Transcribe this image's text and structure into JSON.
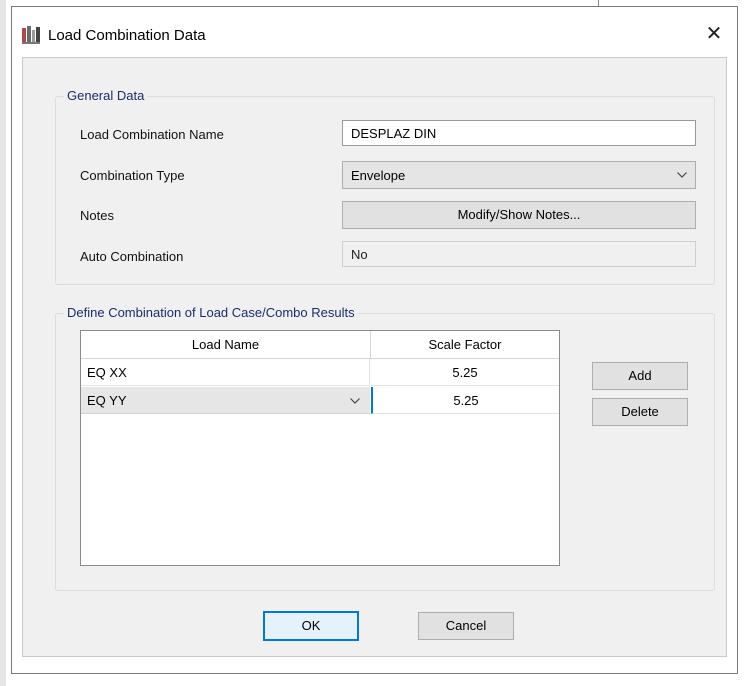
{
  "window": {
    "title": "Load Combination Data",
    "close_glyph": "✕",
    "icon": "app-grid-icon"
  },
  "general": {
    "legend": "General Data",
    "name_label": "Load Combination Name",
    "name_value": "DESPLAZ DIN",
    "type_label": "Combination Type",
    "type_value": "Envelope",
    "notes_label": "Notes",
    "notes_button": "Modify/Show Notes...",
    "auto_label": "Auto Combination",
    "auto_value": "No"
  },
  "define": {
    "legend": "Define Combination of Load Case/Combo Results",
    "columns": [
      "Load Name",
      "Scale Factor"
    ],
    "rows": [
      {
        "load_name": "EQ XX",
        "scale_factor": "5.25"
      },
      {
        "load_name": "EQ YY",
        "scale_factor": "5.25"
      }
    ],
    "add_button": "Add",
    "delete_button": "Delete"
  },
  "footer": {
    "ok": "OK",
    "cancel": "Cancel"
  },
  "colors": {
    "accent_focus": "#0078d7",
    "legend_text": "#1a2d6b",
    "panel_bg": "#f0f0f0"
  }
}
